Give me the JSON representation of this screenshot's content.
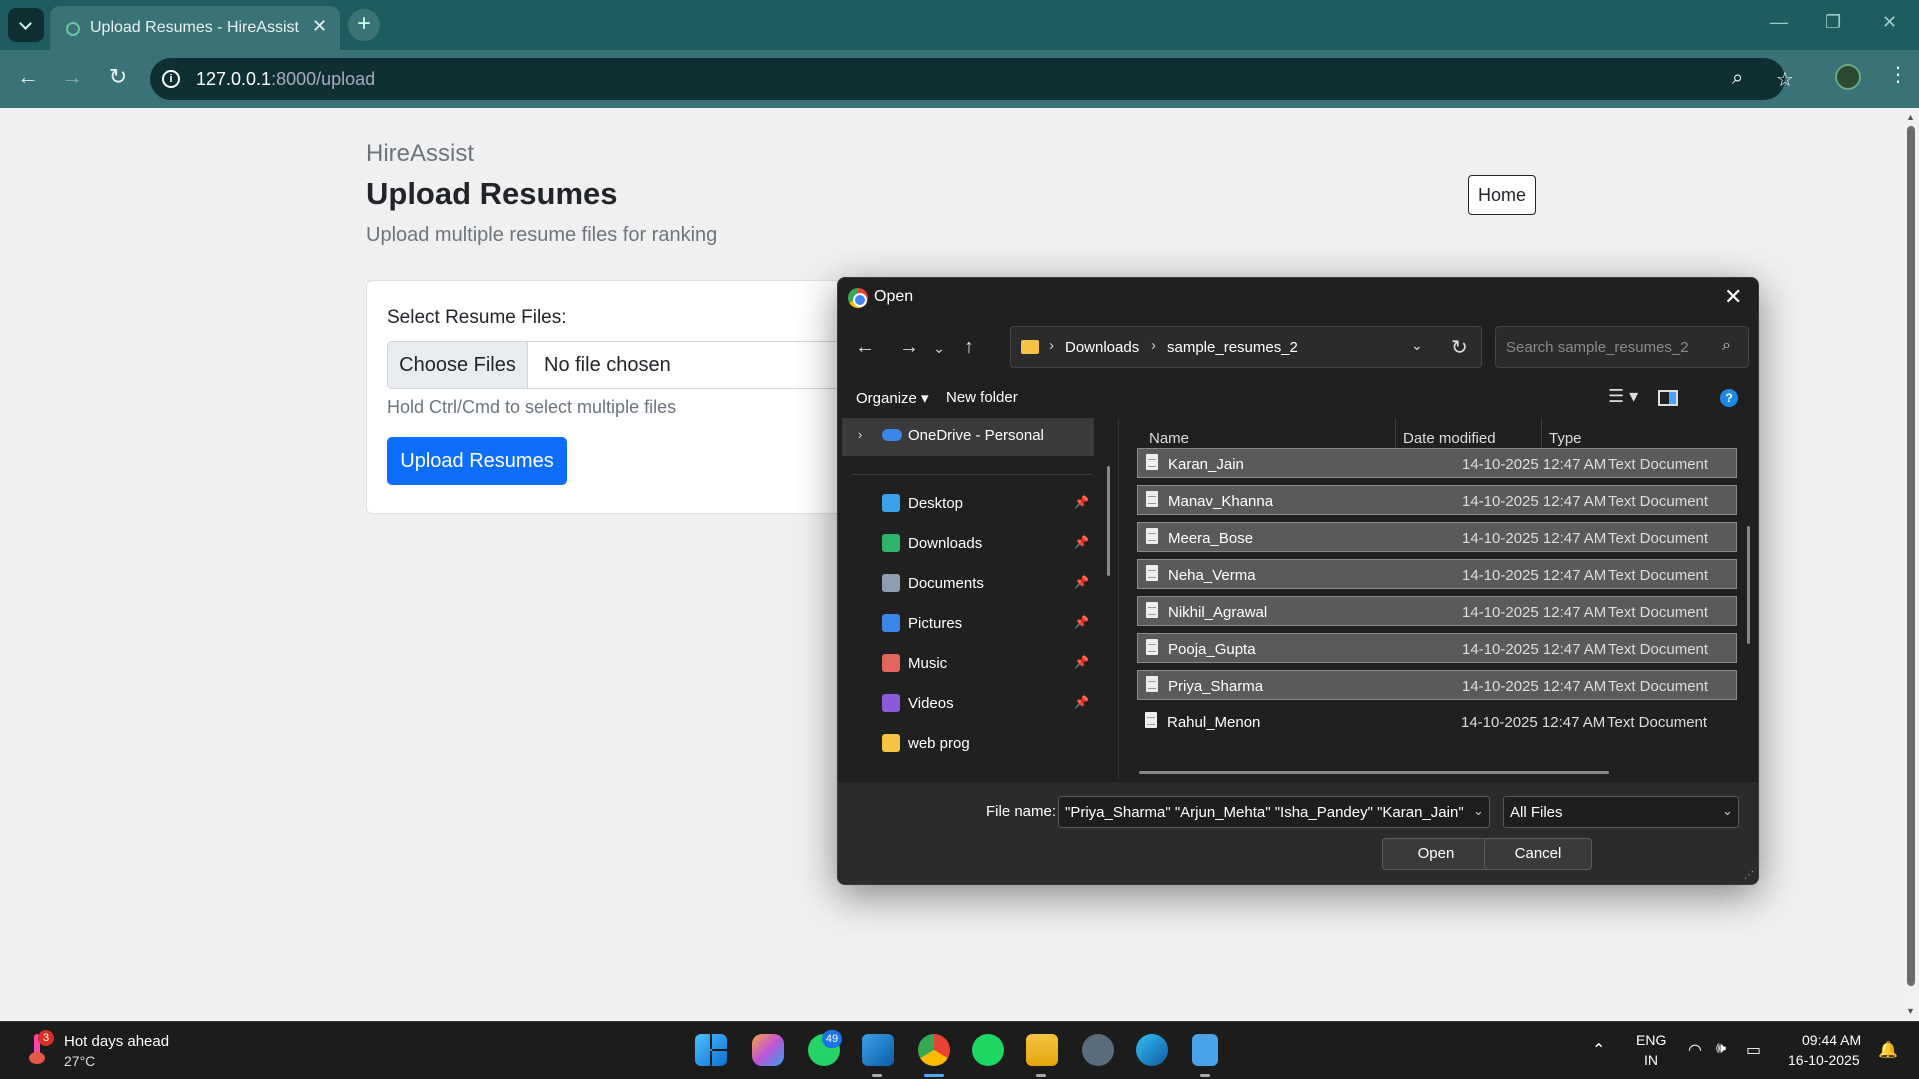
{
  "browser": {
    "tab_title": "Upload Resumes - HireAssist",
    "tab_close": "✕",
    "newtab": "+",
    "url_host": "127.0.0.1",
    "url_path": ":8000/upload"
  },
  "page": {
    "brand": "HireAssist",
    "title": "Upload Resumes",
    "subtitle": "Upload multiple resume files for ranking",
    "home_label": "Home",
    "form": {
      "label": "Select Resume Files:",
      "choose_label": "Choose Files",
      "file_status": "No file chosen",
      "hint": "Hold Ctrl/Cmd to select multiple files",
      "submit_label": "Upload Resumes"
    }
  },
  "dialog": {
    "title": "Open",
    "breadcrumb": [
      "Downloads",
      "sample_resumes_2"
    ],
    "search_placeholder": "Search sample_resumes_2",
    "organize_label": "Organize ▾",
    "new_folder_label": "New folder",
    "nav": {
      "onedrive": "OneDrive - Personal",
      "items": [
        {
          "label": "Desktop",
          "color": "#3aa0e8"
        },
        {
          "label": "Downloads",
          "color": "#2fb36a"
        },
        {
          "label": "Documents",
          "color": "#8e9db0"
        },
        {
          "label": "Pictures",
          "color": "#3a86e8"
        },
        {
          "label": "Music",
          "color": "#e0655a"
        },
        {
          "label": "Videos",
          "color": "#8a5ad8"
        },
        {
          "label": "web prog",
          "color": "#f6c344"
        }
      ]
    },
    "columns": {
      "name": "Name",
      "date": "Date modified",
      "type": "Type"
    },
    "files": [
      {
        "name": "Karan_Jain",
        "date": "14-10-2025 12:47 AM",
        "type": "Text Document",
        "selected": true
      },
      {
        "name": "Manav_Khanna",
        "date": "14-10-2025 12:47 AM",
        "type": "Text Document",
        "selected": true
      },
      {
        "name": "Meera_Bose",
        "date": "14-10-2025 12:47 AM",
        "type": "Text Document",
        "selected": true
      },
      {
        "name": "Neha_Verma",
        "date": "14-10-2025 12:47 AM",
        "type": "Text Document",
        "selected": true
      },
      {
        "name": "Nikhil_Agrawal",
        "date": "14-10-2025 12:47 AM",
        "type": "Text Document",
        "selected": true
      },
      {
        "name": "Pooja_Gupta",
        "date": "14-10-2025 12:47 AM",
        "type": "Text Document",
        "selected": true
      },
      {
        "name": "Priya_Sharma",
        "date": "14-10-2025 12:47 AM",
        "type": "Text Document",
        "selected": true
      },
      {
        "name": "Rahul_Menon",
        "date": "14-10-2025 12:47 AM",
        "type": "Text Document",
        "selected": false
      }
    ],
    "file_name_label": "File name:",
    "file_name_value": "\"Priya_Sharma\" \"Arjun_Mehta\" \"Isha_Pandey\" \"Karan_Jain\" \"M",
    "file_type_value": "All Files",
    "open_label": "Open",
    "cancel_label": "Cancel"
  },
  "taskbar": {
    "weather_title": "Hot days ahead",
    "weather_temp": "27°C",
    "weather_badge": "3",
    "whatsapp_badge": "49",
    "lang_top": "ENG",
    "lang_bottom": "IN",
    "time": "09:44 AM",
    "date": "16-10-2025"
  }
}
